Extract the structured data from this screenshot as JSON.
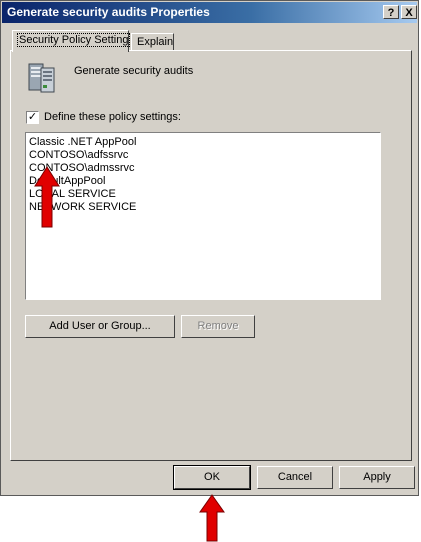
{
  "window": {
    "title": "Generate security audits Properties",
    "help_button": "?",
    "close_button": "X"
  },
  "tabs": [
    {
      "label": "Security Policy Setting",
      "active": true
    },
    {
      "label": "Explain",
      "active": false
    }
  ],
  "policy": {
    "name": "Generate security audits",
    "icon": "server-policy-icon"
  },
  "define_settings": {
    "label": "Define these policy settings:",
    "checked": true,
    "check_mark": "✓"
  },
  "accounts": [
    "Classic .NET AppPool",
    "CONTOSO\\adfssrvc",
    "CONTOSO\\admssrvc",
    "DefaultAppPool",
    "LOCAL SERVICE",
    "NETWORK SERVICE"
  ],
  "buttons": {
    "add_user": "Add User or Group...",
    "remove": "Remove",
    "ok": "OK",
    "cancel": "Cancel",
    "apply": "Apply"
  },
  "annotations": {
    "arrow_color": "#e00000",
    "arrow_icon": "red-up-arrow-icon"
  }
}
